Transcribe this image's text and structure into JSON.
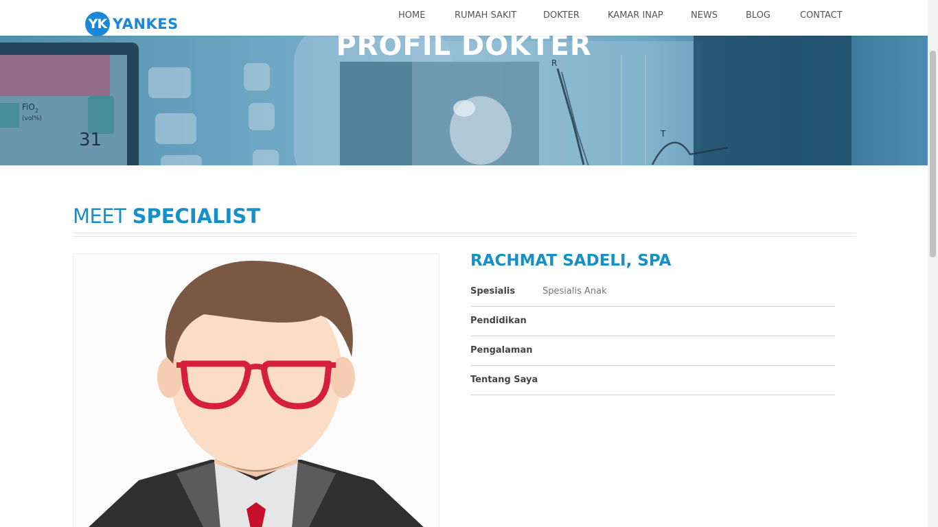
{
  "brand": {
    "badge": "YK",
    "name": "YANKES"
  },
  "nav": {
    "items": [
      {
        "label": "HOME"
      },
      {
        "label": "RUMAH SAKIT"
      },
      {
        "label": "DOKTER"
      },
      {
        "label": "KAMAR INAP"
      },
      {
        "label": "NEWS"
      },
      {
        "label": "BLOG"
      },
      {
        "label": "CONTACT"
      }
    ]
  },
  "hero": {
    "title": "PROFIL DOKTER",
    "monitor_text": {
      "fio2": "FiO",
      "fio2_sub": "2",
      "unit": "(vol%)",
      "value": "31",
      "lead_r": "R",
      "lead_t": "T"
    }
  },
  "section": {
    "title_light": "MEET",
    "title_bold": "SPECIALIST"
  },
  "doctor": {
    "name": "RACHMAT SADELI, SPA",
    "fields": [
      {
        "label": "Spesialis",
        "value": "Spesialis Anak"
      },
      {
        "label": "Pendidikan",
        "value": ""
      },
      {
        "label": "Pengalaman",
        "value": ""
      },
      {
        "label": "Tentang Saya",
        "value": ""
      }
    ]
  },
  "colors": {
    "accent": "#1690c8",
    "logo": "#1a87d8",
    "nav_text": "#555555"
  }
}
